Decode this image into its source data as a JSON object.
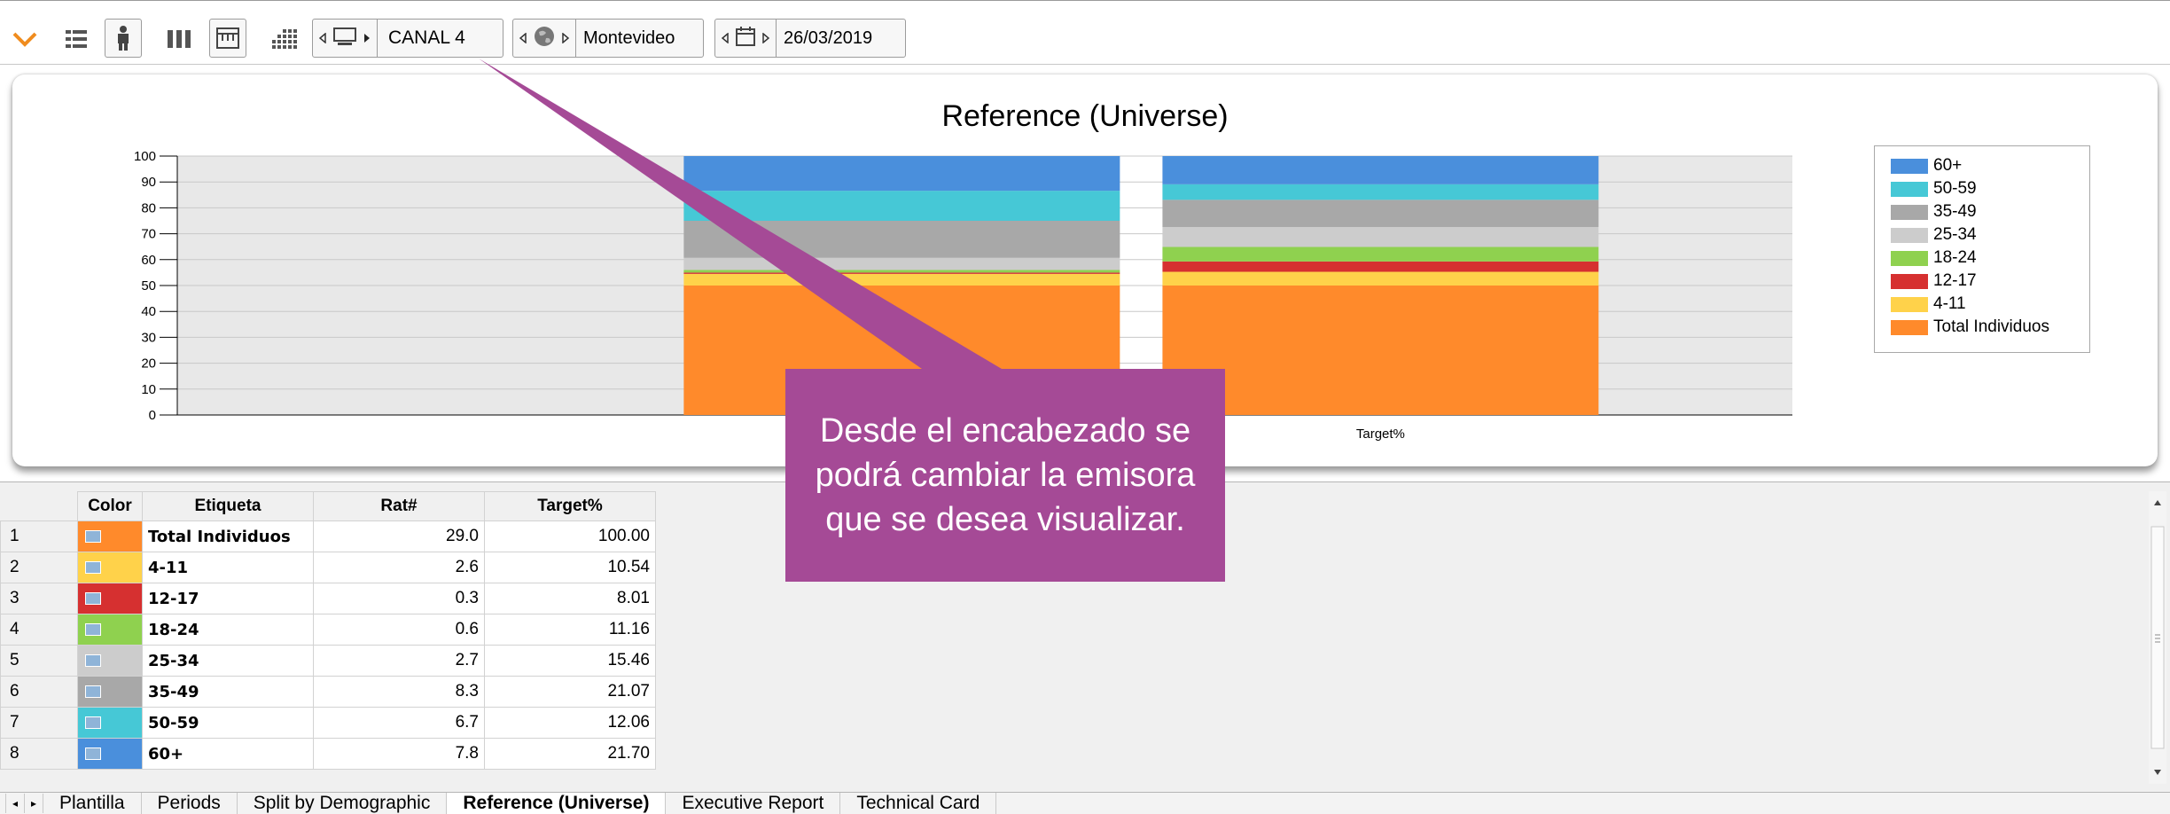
{
  "toolbar": {
    "channel": "CANAL 4",
    "city": "Montevideo",
    "date": "26/03/2019"
  },
  "chart": {
    "title": "Reference (Universe)"
  },
  "chart_data": {
    "type": "bar",
    "stacked": true,
    "title": "Reference (Universe)",
    "categories": [
      "Rat#",
      "Target%"
    ],
    "ylim": [
      0,
      100
    ],
    "yticks": [
      0,
      10,
      20,
      30,
      40,
      50,
      60,
      70,
      80,
      90,
      100
    ],
    "grid": true,
    "legend_position": "right",
    "series": [
      {
        "name": "Total Individuos",
        "color": "#ff8a2b",
        "values": [
          50.0,
          50.0
        ]
      },
      {
        "name": "4-11",
        "color": "#ffd24a",
        "values": [
          4.5,
          5.3
        ]
      },
      {
        "name": "12-17",
        "color": "#d63030",
        "values": [
          0.5,
          4.0
        ]
      },
      {
        "name": "18-24",
        "color": "#8fd14f",
        "values": [
          1.0,
          5.6
        ]
      },
      {
        "name": "25-34",
        "color": "#cccccc",
        "values": [
          4.7,
          7.7
        ]
      },
      {
        "name": "35-49",
        "color": "#a8a8a8",
        "values": [
          14.3,
          10.5
        ]
      },
      {
        "name": "50-59",
        "color": "#46c8d6",
        "values": [
          11.6,
          6.0
        ]
      },
      {
        "name": "60+",
        "color": "#4a8fdc",
        "values": [
          13.4,
          10.9
        ]
      }
    ]
  },
  "table": {
    "headers": [
      "Color",
      "Etiqueta",
      "Rat#",
      "Target%"
    ],
    "rows": [
      {
        "n": "1",
        "label": "Total Individuos",
        "rat": "29.0",
        "target": "100.00",
        "color": "#ff8a2b"
      },
      {
        "n": "2",
        "label": "4-11",
        "rat": "2.6",
        "target": "10.54",
        "color": "#ffd24a"
      },
      {
        "n": "3",
        "label": "12-17",
        "rat": "0.3",
        "target": "8.01",
        "color": "#d63030"
      },
      {
        "n": "4",
        "label": "18-24",
        "rat": "0.6",
        "target": "11.16",
        "color": "#8fd14f"
      },
      {
        "n": "5",
        "label": "25-34",
        "rat": "2.7",
        "target": "15.46",
        "color": "#cccccc"
      },
      {
        "n": "6",
        "label": "35-49",
        "rat": "8.3",
        "target": "21.07",
        "color": "#a8a8a8"
      },
      {
        "n": "7",
        "label": "50-59",
        "rat": "6.7",
        "target": "12.06",
        "color": "#46c8d6"
      },
      {
        "n": "8",
        "label": "60+",
        "rat": "7.8",
        "target": "21.70",
        "color": "#4a8fdc"
      }
    ]
  },
  "tabs": [
    "Plantilla",
    "Periods",
    "Split by Demographic",
    "Reference (Universe)",
    "Executive Report",
    "Technical Card"
  ],
  "active_tab": "Reference (Universe)",
  "callout": {
    "text": "Desde el encabezado se podrá cambiar la emisora que se desea visualizar."
  },
  "colors": {
    "callout": "#a54a96",
    "accent_chevron": "#f08c1e"
  },
  "icons": [
    "chevron-down-icon",
    "list-icon",
    "person-icon",
    "columns-icon",
    "calendar-grid-icon",
    "grid-dots-icon",
    "monitor-icon",
    "globe-icon",
    "calendar-icon"
  ]
}
